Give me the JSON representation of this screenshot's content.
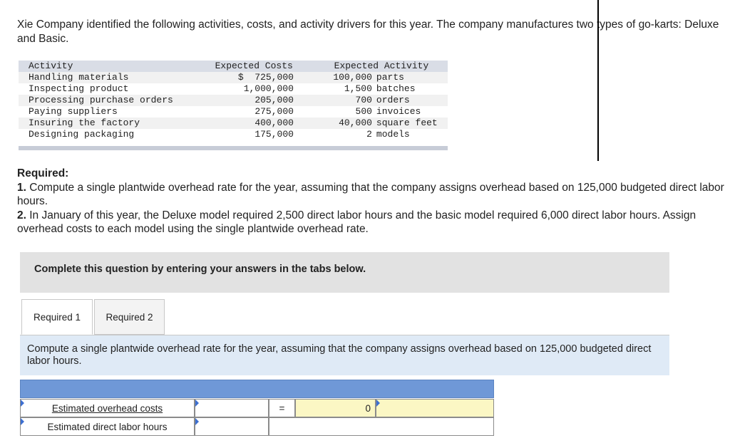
{
  "intro_text": "Xie Company identified the following activities, costs, and activity drivers for this year. The company manufactures two types of go-karts: Deluxe and Basic.",
  "activity_table": {
    "headers": {
      "activity": "Activity",
      "cost": "Expected Costs",
      "driver": "Expected Activity"
    },
    "rows": [
      {
        "activity": "Handling materials",
        "cost": "$  725,000",
        "qty": "100,000",
        "unit": "parts"
      },
      {
        "activity": "Inspecting product",
        "cost": "1,000,000",
        "qty": "1,500",
        "unit": "batches"
      },
      {
        "activity": "Processing purchase orders",
        "cost": "205,000",
        "qty": "700",
        "unit": "orders"
      },
      {
        "activity": "Paying suppliers",
        "cost": "275,000",
        "qty": "500",
        "unit": "invoices"
      },
      {
        "activity": "Insuring the factory",
        "cost": "400,000",
        "qty": "40,000",
        "unit": "square feet"
      },
      {
        "activity": "Designing packaging",
        "cost": "175,000",
        "qty": "2",
        "unit": "models"
      }
    ]
  },
  "required": {
    "heading": "Required:",
    "item1_num": "1.",
    "item1_text": " Compute a single plantwide overhead rate for the year, assuming that the company assigns overhead based on 125,000 budgeted direct labor hours.",
    "item2_num": "2.",
    "item2_text": " In January of this year, the Deluxe model required 2,500 direct labor hours and the basic model required 6,000 direct labor hours. Assign overhead costs to each model using the single plantwide overhead rate."
  },
  "instruction": "Complete this question by entering your answers in the tabs below.",
  "tabs": [
    {
      "label": "Required 1",
      "active": true
    },
    {
      "label": "Required 2",
      "active": false
    }
  ],
  "tab_prompt": "Compute a single plantwide overhead rate for the year, assuming that the company assigns overhead based on 125,000 budgeted direct labor hours.",
  "answer_grid": {
    "row1_label": "Estimated overhead costs",
    "row2_label": "Estimated direct labor hours",
    "equals_sign": "=",
    "result_value": "0"
  },
  "colors": {
    "header_blue": "#6f98d7",
    "input_marker": "#3c6fd1",
    "result_yellow": "#fbf7c4",
    "instruction_bg": "#e2e2e2",
    "prompt_bg": "#dfeaf6"
  }
}
